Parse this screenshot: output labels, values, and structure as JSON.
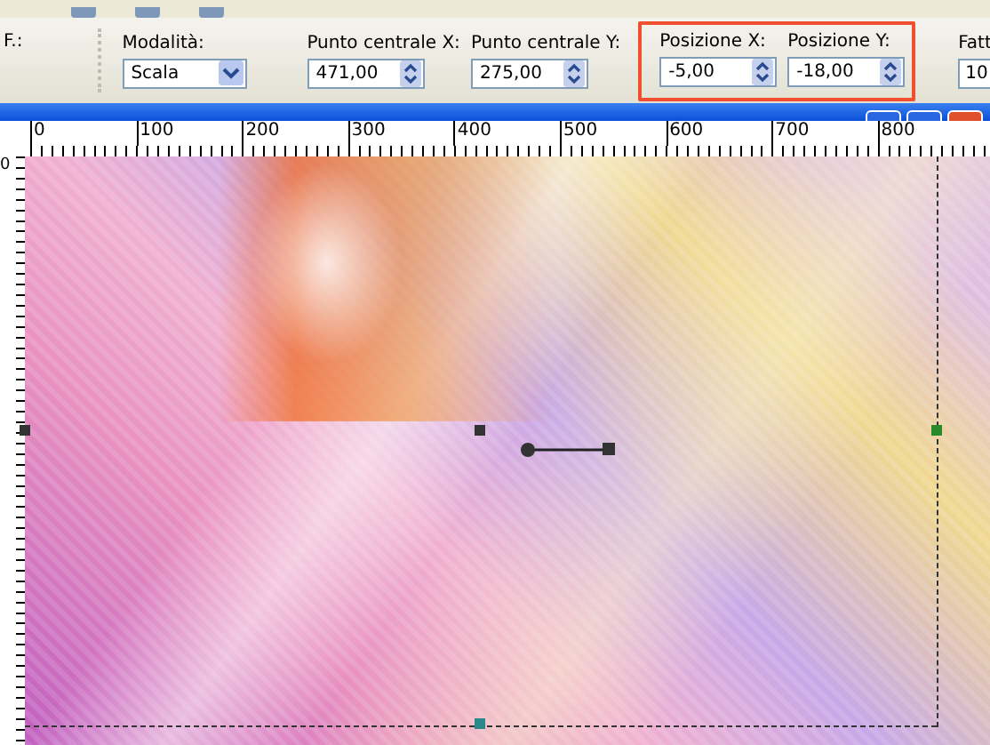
{
  "tool_options": {
    "left_label": "F.:",
    "mode": {
      "label": "Modalità:",
      "value": "Scala"
    },
    "field_groups": [
      {
        "highlighted": false,
        "fields": [
          {
            "label": "Punto centrale X:",
            "value": "471,00"
          },
          {
            "label": "Punto centrale Y:",
            "value": "275,00"
          }
        ]
      },
      {
        "highlighted": true,
        "fields": [
          {
            "label": "Posizione X:",
            "value": "-5,00"
          },
          {
            "label": "Posizione Y:",
            "value": "-18,00"
          }
        ]
      }
    ],
    "scale": {
      "label": "Fatt",
      "value": "10"
    }
  },
  "ruler": {
    "horizontal": [
      "0",
      "100",
      "200",
      "300",
      "400",
      "500",
      "600",
      "700",
      "800"
    ],
    "vertical": [
      "0"
    ]
  }
}
